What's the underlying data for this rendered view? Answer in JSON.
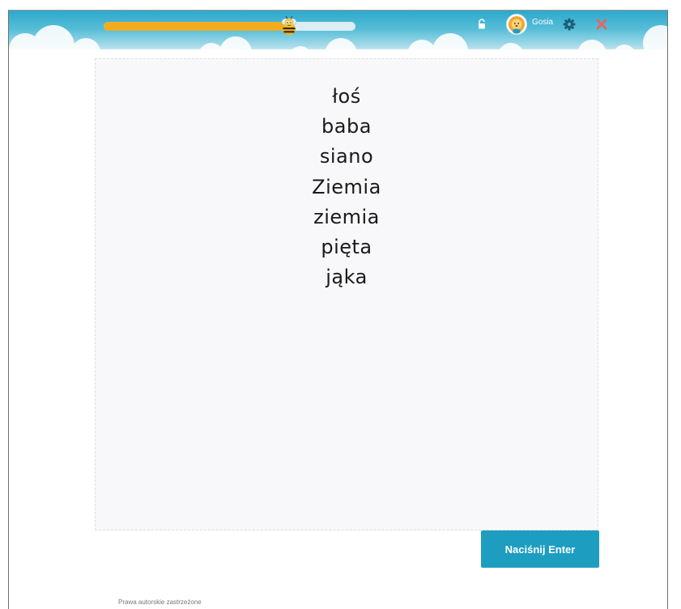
{
  "header": {
    "progress": {
      "fraction": 0.74,
      "fill_color": "#f1ad22",
      "track_color": "#dceef4"
    },
    "progress_marker_icon": "bee-icon",
    "lock_icon": "lock-icon",
    "user": {
      "name": "Gosia",
      "avatar_icon": "lion-avatar-icon"
    },
    "settings_icon": "gear-icon",
    "close_icon": "close-icon",
    "background_color": "#2da8cc"
  },
  "exercise": {
    "words": [
      "łoś",
      "baba",
      "siano",
      "Ziemia",
      "ziemia",
      "pięta",
      "jąka"
    ]
  },
  "actions": {
    "enter_label": "Naciśnij Enter",
    "enter_color": "#1d9ec1"
  },
  "footer": {
    "text": "Prawa autorskie zastrzeżone"
  }
}
